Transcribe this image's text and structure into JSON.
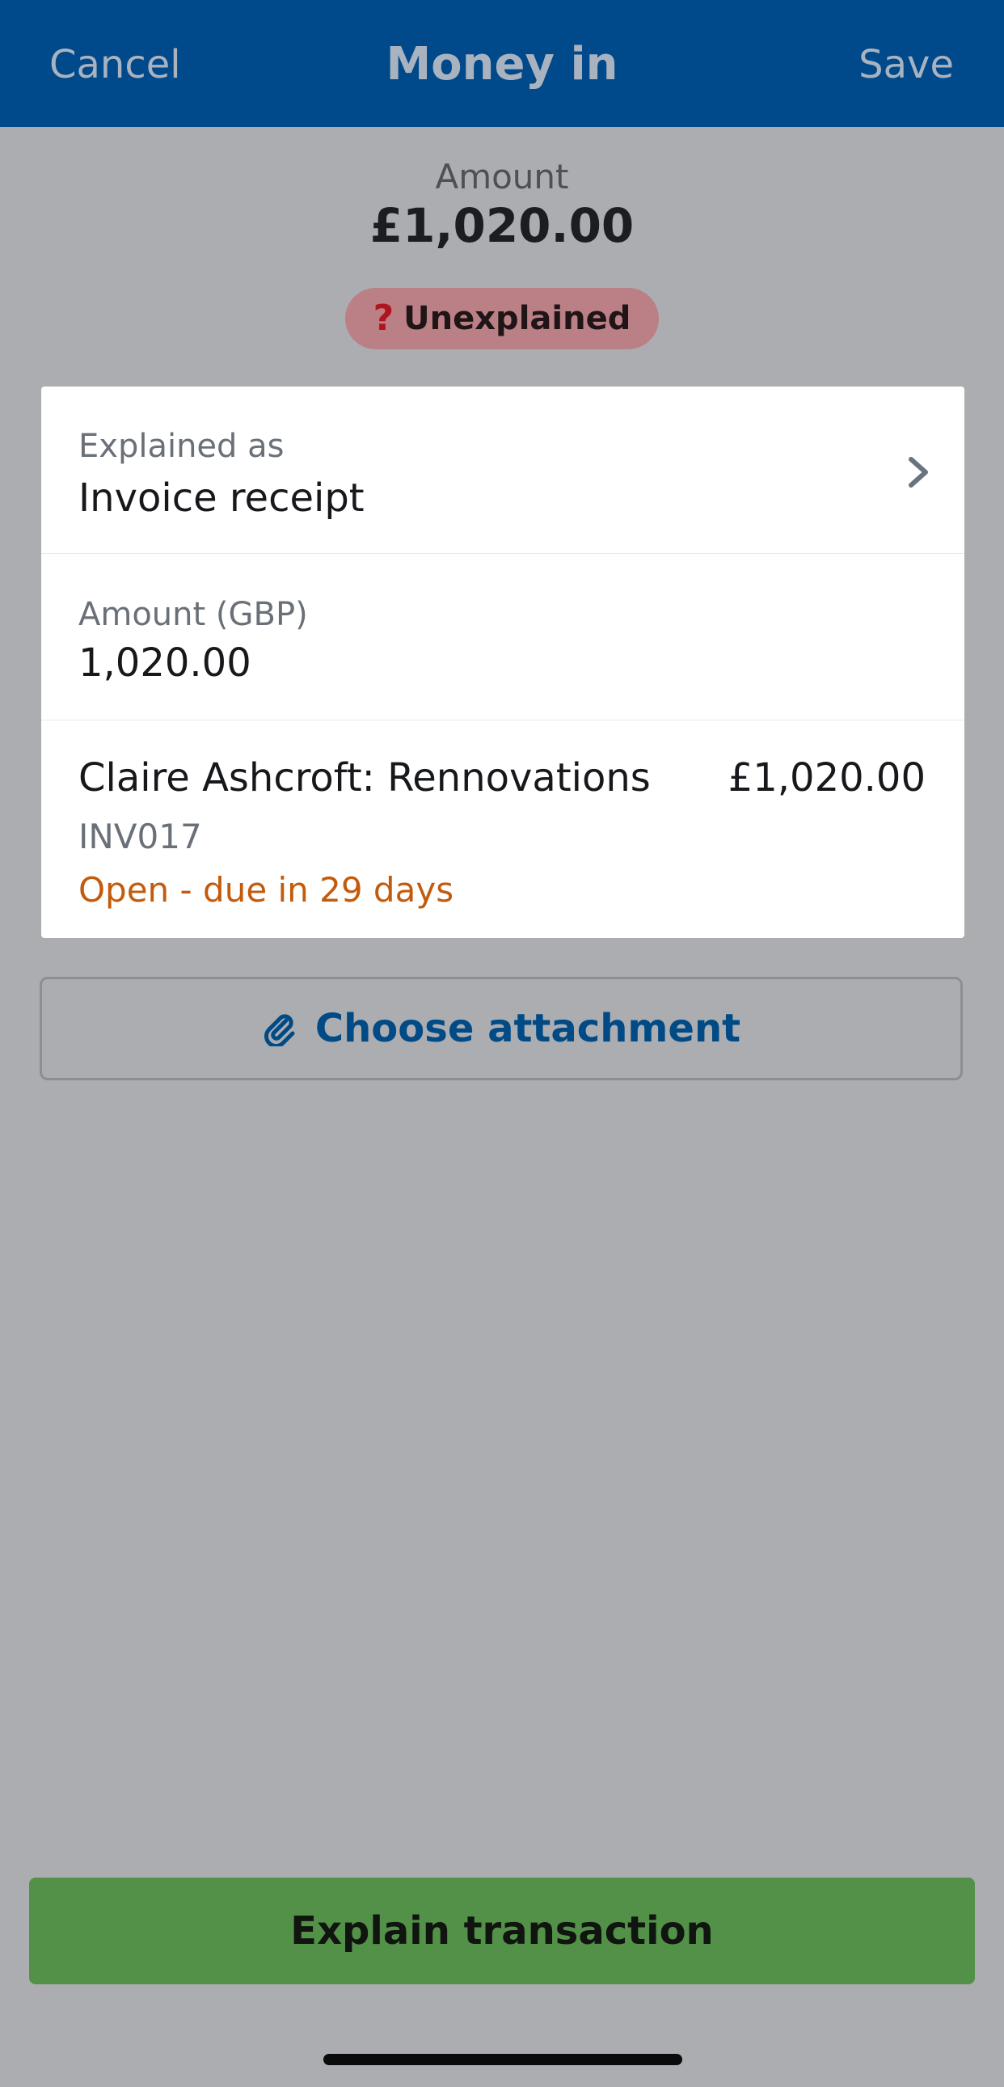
{
  "header": {
    "cancel_label": "Cancel",
    "title": "Money in",
    "save_label": "Save"
  },
  "summary": {
    "amount_label": "Amount",
    "amount_value": "£1,020.00",
    "status_icon": "question-mark-icon",
    "status_glyph": "?",
    "status_label": "Unexplained",
    "status_color": "#b1141f"
  },
  "form": {
    "explained_as_label": "Explained as",
    "explained_as_value": "Invoice receipt",
    "amount_label": "Amount (GBP)",
    "amount_value": "1,020.00"
  },
  "invoice": {
    "name": "Claire Ashcroft: Rennovations",
    "amount": "£1,020.00",
    "reference": "INV017",
    "status": "Open - due in 29 days",
    "status_color": "#c35b0d"
  },
  "attachment": {
    "icon": "paperclip-icon",
    "label": "Choose attachment"
  },
  "footer": {
    "explain_label": "Explain transaction",
    "explain_color": "#539149"
  },
  "colors": {
    "header_bg": "#00498a",
    "overlay_bg": "#acadb1",
    "link": "#004a86"
  }
}
